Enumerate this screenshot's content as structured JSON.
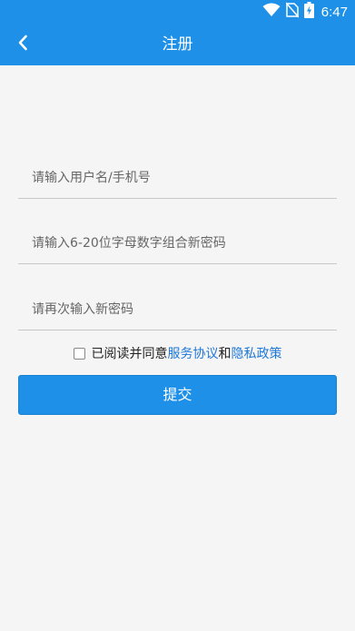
{
  "status_bar": {
    "time": "6:47",
    "icons": [
      "wifi-icon",
      "no-sim-icon",
      "battery-charging-icon"
    ]
  },
  "header": {
    "title": "注册",
    "back_icon": "chevron-left-icon"
  },
  "form": {
    "username_placeholder": "请输入用户名/手机号",
    "password_placeholder": "请输入6-20位字母数字组合新密码",
    "confirm_placeholder": "请再次输入新密码",
    "username_value": "",
    "password_value": "",
    "confirm_value": ""
  },
  "agreement": {
    "checked": false,
    "prefix": "已阅读并同意",
    "service_link": "服务协议",
    "and": "和",
    "privacy_link": "隐私政策"
  },
  "submit_label": "提交",
  "colors": {
    "primary": "#1e90e8",
    "link": "#1e78d8",
    "background": "#f5f5f5"
  }
}
